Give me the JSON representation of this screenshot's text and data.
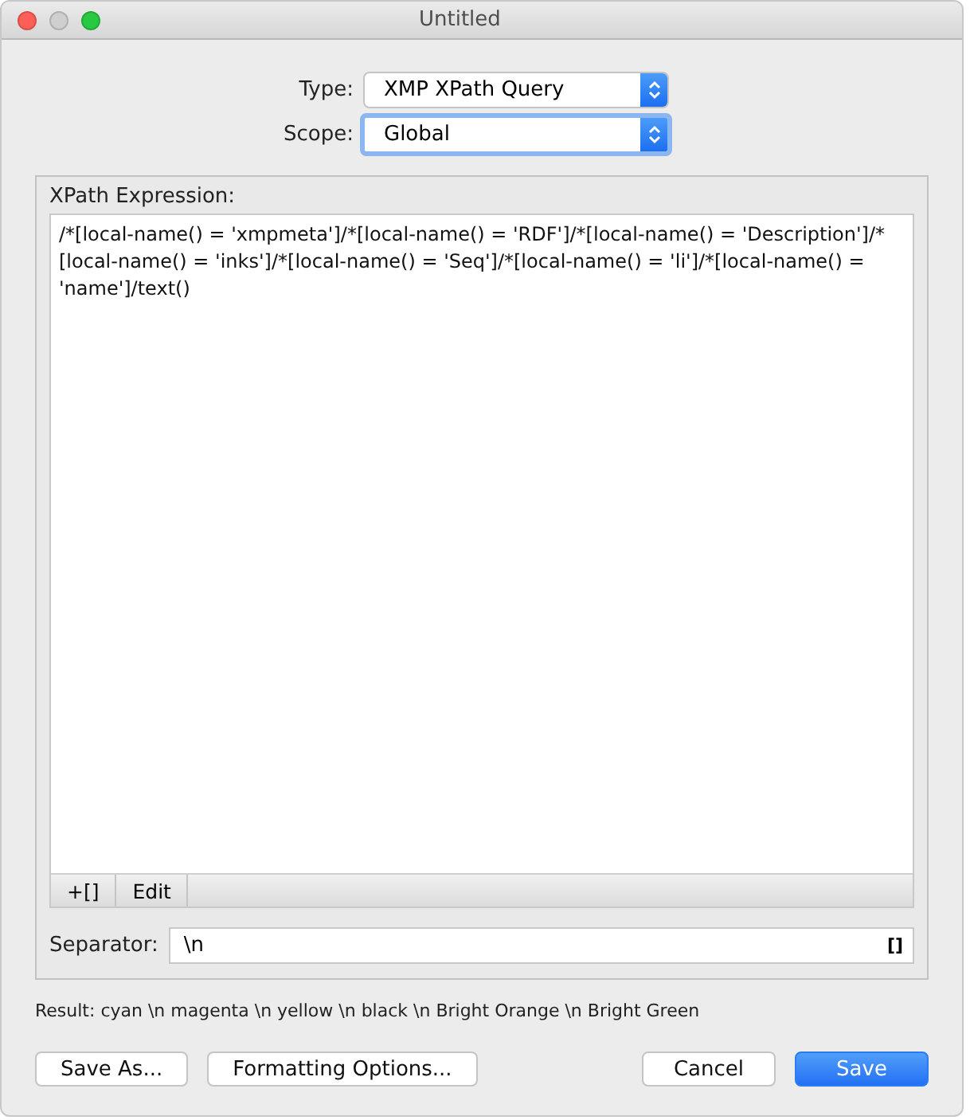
{
  "window": {
    "title": "Untitled"
  },
  "selects": [
    {
      "label": "Type:",
      "value": "XMP XPath Query",
      "focused": false
    },
    {
      "label": "Scope:",
      "value": "Global",
      "focused": true
    }
  ],
  "expression": {
    "label": "XPath Expression:",
    "value": "/*[local-name() = 'xmpmeta']/*[local-name() = 'RDF']/*[local-name() = 'Description']/*[local-name() = 'inks']/*[local-name() = 'Seq']/*[local-name() = 'li']/*[local-name() = 'name']/text()",
    "toolbar": [
      "+[]",
      "Edit"
    ]
  },
  "separator": {
    "label": "Separator:",
    "value": "\\n",
    "button": "[]"
  },
  "result": "Result:  cyan \\n magenta \\n yellow \\n black \\n Bright Orange \\n Bright Green",
  "buttons_left": [
    "Save As...",
    "Formatting Options..."
  ],
  "buttons_right": [
    {
      "label": "Cancel",
      "kind": "normal"
    },
    {
      "label": "Save",
      "kind": "default"
    }
  ]
}
